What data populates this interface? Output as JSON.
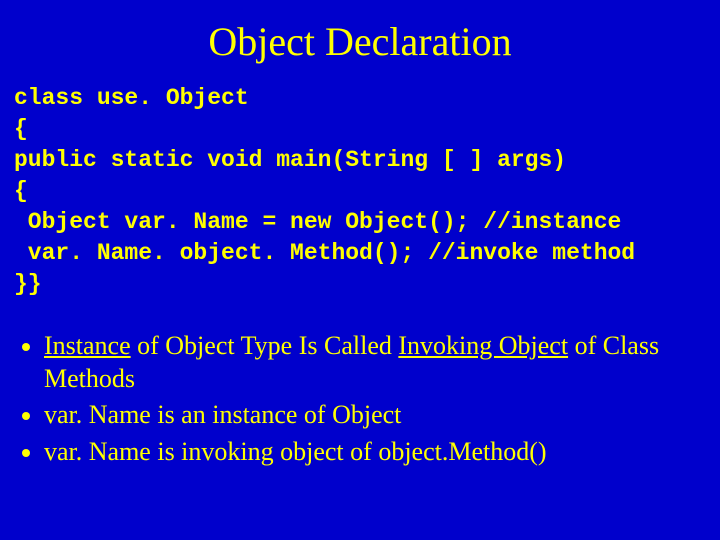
{
  "title": "Object Declaration",
  "code": {
    "l1": "class use. Object",
    "l2": "{",
    "l3": "public static void main(String [ ] args)",
    "l4": "{",
    "l5": " Object var. Name = new Object(); //instance",
    "l6": " var. Name. object. Method(); //invoke method",
    "l7": "}}"
  },
  "bullets": {
    "b1a": "Instance",
    "b1b": " of Object Type Is Called ",
    "b1c": "Invoking Object",
    "b1d": " of Class Methods",
    "b2": "var. Name is an instance of Object",
    "b3": "var. Name is invoking object of object.Method()"
  }
}
